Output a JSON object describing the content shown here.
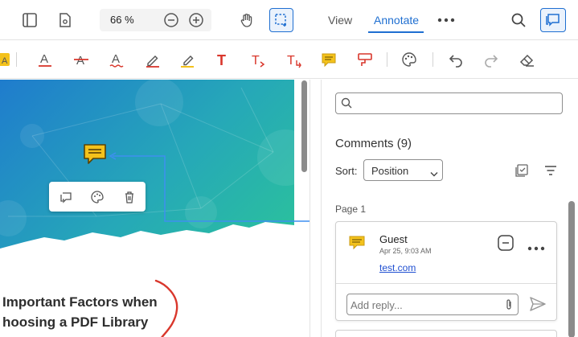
{
  "toolbar": {
    "zoom_value": "66",
    "zoom_unit": "%",
    "tabs": [
      {
        "label": "View",
        "active": false
      },
      {
        "label": "Annotate",
        "active": true
      }
    ]
  },
  "document": {
    "heading_line1": "Important Factors when",
    "heading_line2": "hoosing a PDF Library"
  },
  "sidebar": {
    "search_placeholder": "",
    "comments_label": "Comments",
    "comments_count": "(9)",
    "sort_label": "Sort:",
    "sort_value": "Position",
    "page_label": "Page 1",
    "comment": {
      "author": "Guest",
      "date": "Apr 25, 9:03 AM",
      "text": "test.com"
    },
    "reply_placeholder": "Add reply..."
  },
  "colors": {
    "accent": "#1f6fd1",
    "note_yellow": "#f4c21b",
    "annotation_red": "#d9372c"
  }
}
